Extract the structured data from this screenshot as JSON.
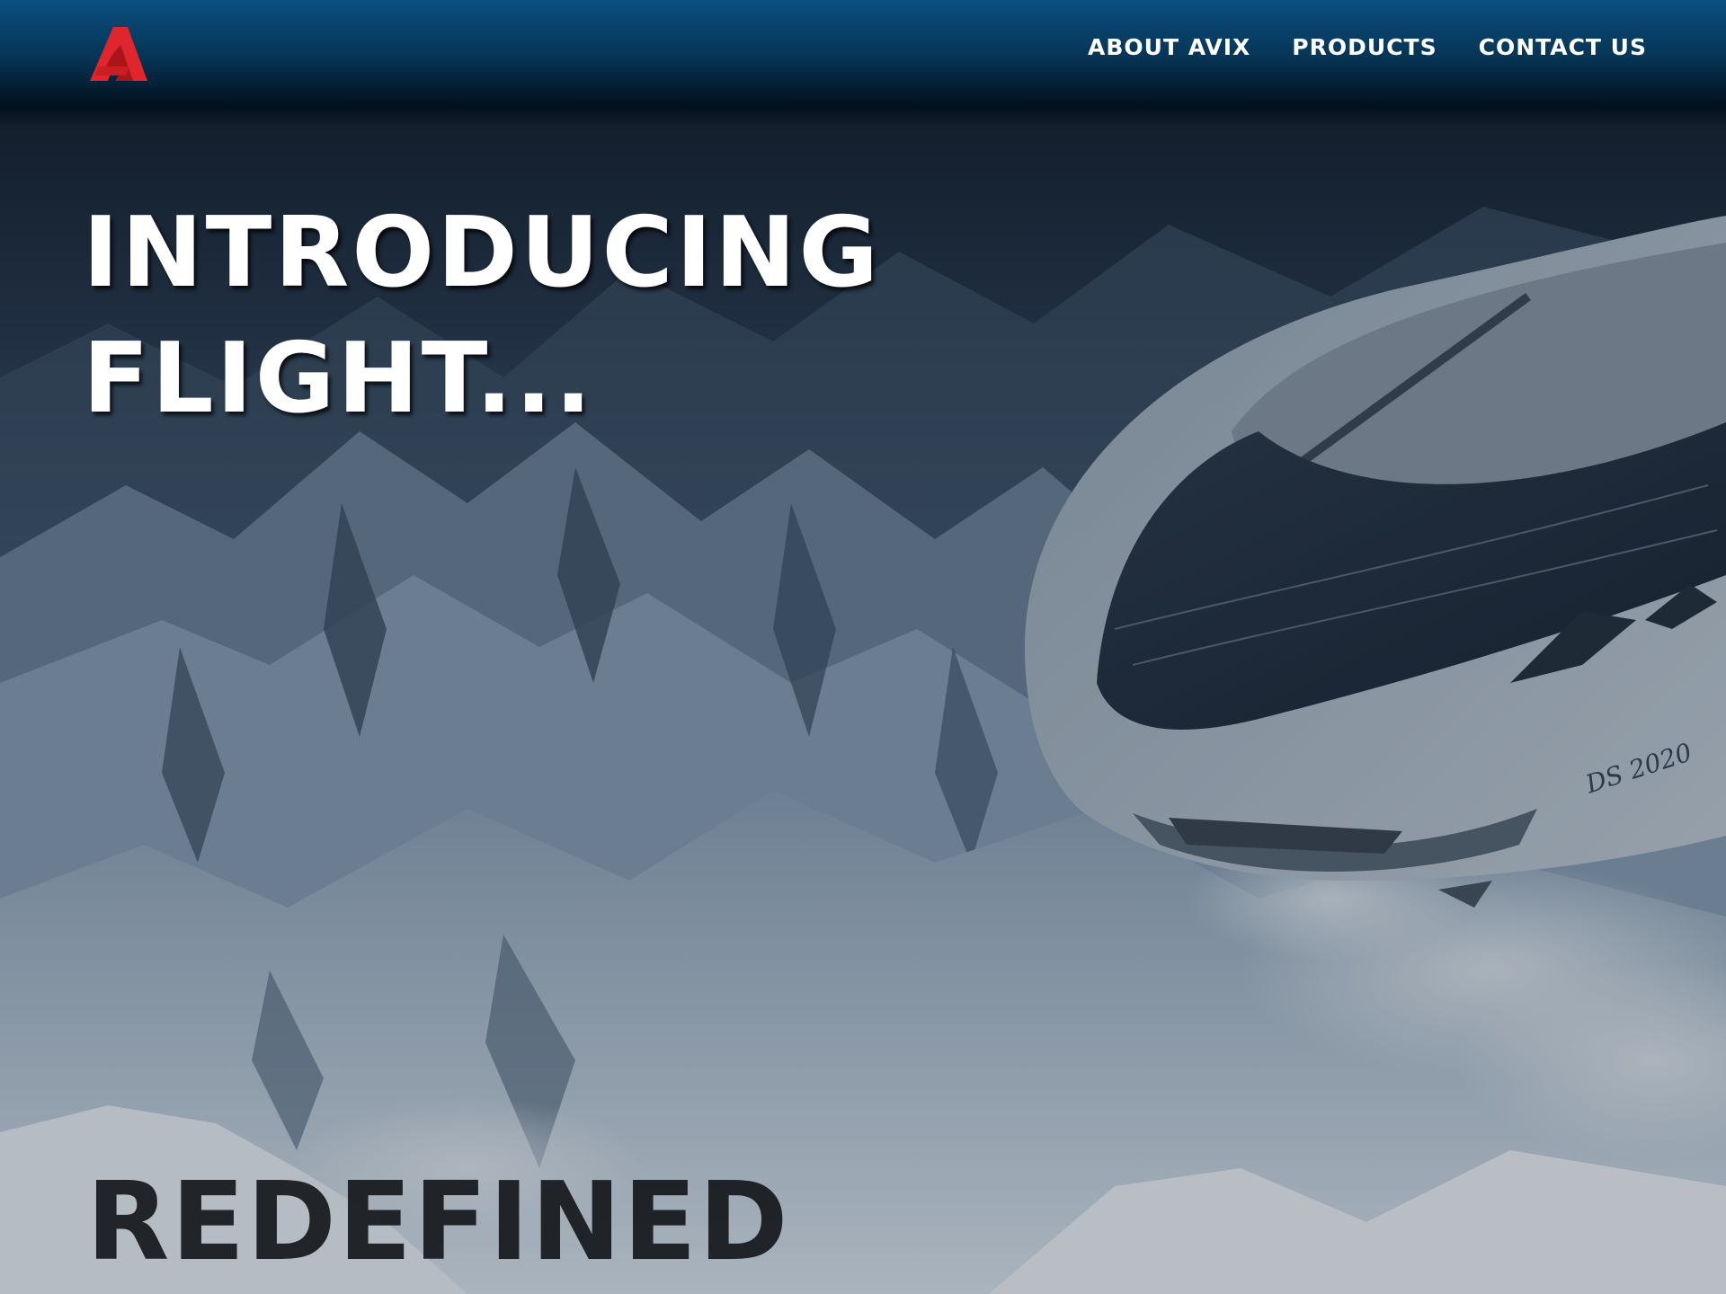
{
  "brand": {
    "logo_icon": "avix-a-logo",
    "color": "#e0262c"
  },
  "nav": {
    "items": [
      {
        "label": "ABOUT AVIX"
      },
      {
        "label": "PRODUCTS"
      },
      {
        "label": "CONTACT US"
      }
    ]
  },
  "hero": {
    "headline_line1": "INTRODUCING",
    "headline_line2": "FLIGHT...",
    "tagline": "REDEFINED",
    "hull_marking": "DS 2020",
    "image": "airship-over-snowy-mountains"
  },
  "colors": {
    "header_top": "#0b4f80",
    "header_bottom": "#02101c",
    "headline": "#ffffff",
    "tagline": "#15181c"
  }
}
